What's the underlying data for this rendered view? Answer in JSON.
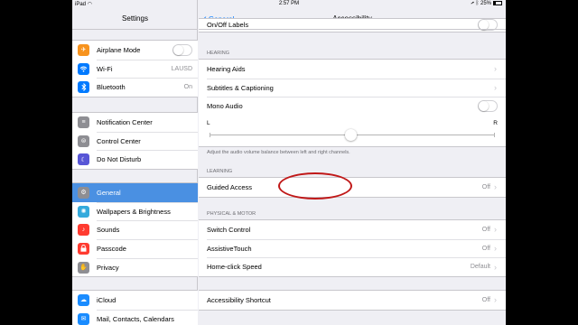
{
  "status": {
    "device": "iPad",
    "time": "2:57 PM",
    "battery": "25%",
    "battery_level": 0.25
  },
  "sidebar": {
    "title": "Settings",
    "groups": [
      [
        {
          "label": "Airplane Mode",
          "icon": "airplane-icon",
          "color": "#f7931e",
          "control": "toggle",
          "toggle_on": false
        },
        {
          "label": "Wi-Fi",
          "icon": "wifi-icon",
          "color": "#007aff",
          "value": "LAUSD"
        },
        {
          "label": "Bluetooth",
          "icon": "bluetooth-icon",
          "color": "#007aff",
          "value": "On"
        }
      ],
      [
        {
          "label": "Notification Center",
          "icon": "notification-center-icon",
          "color": "#8e8e93"
        },
        {
          "label": "Control Center",
          "icon": "control-center-icon",
          "color": "#8e8e93"
        },
        {
          "label": "Do Not Disturb",
          "icon": "moon-icon",
          "color": "#5856d6"
        }
      ],
      [
        {
          "label": "General",
          "icon": "gear-icon",
          "color": "#8e8e93",
          "selected": true
        },
        {
          "label": "Wallpapers & Brightness",
          "icon": "wallpaper-icon",
          "color": "#34aadc"
        },
        {
          "label": "Sounds",
          "icon": "speaker-icon",
          "color": "#ff3b30"
        },
        {
          "label": "Passcode",
          "icon": "lock-icon",
          "color": "#ff3b30"
        },
        {
          "label": "Privacy",
          "icon": "hand-icon",
          "color": "#8e8e93"
        }
      ],
      [
        {
          "label": "iCloud",
          "icon": "cloud-icon",
          "color": "#1a8cff"
        },
        {
          "label": "Mail, Contacts, Calendars",
          "icon": "mail-icon",
          "color": "#1a8cff"
        }
      ]
    ]
  },
  "detail": {
    "back_label": "General",
    "title": "Accessibility",
    "partial_row": {
      "label": "On/Off Labels"
    },
    "hearing": {
      "header": "HEARING",
      "hearing_aids": "Hearing Aids",
      "subtitles": "Subtitles & Captioning",
      "mono_audio": "Mono Audio",
      "balance_left": "L",
      "balance_right": "R",
      "balance_position": 0.5,
      "footer": "Adjust the audio volume balance between left and right channels."
    },
    "learning": {
      "header": "LEARNING",
      "guided_access": "Guided Access",
      "guided_access_value": "Off"
    },
    "physical": {
      "header": "PHYSICAL & MOTOR",
      "switch_control": "Switch Control",
      "switch_control_value": "Off",
      "assistive_touch": "AssistiveTouch",
      "assistive_touch_value": "Off",
      "home_click": "Home-click Speed",
      "home_click_value": "Default"
    },
    "shortcut": {
      "label": "Accessibility Shortcut",
      "value": "Off"
    }
  },
  "colors": {
    "accent": "#007aff",
    "selected_row": "#4a90e2",
    "annotation": "#c01818"
  }
}
